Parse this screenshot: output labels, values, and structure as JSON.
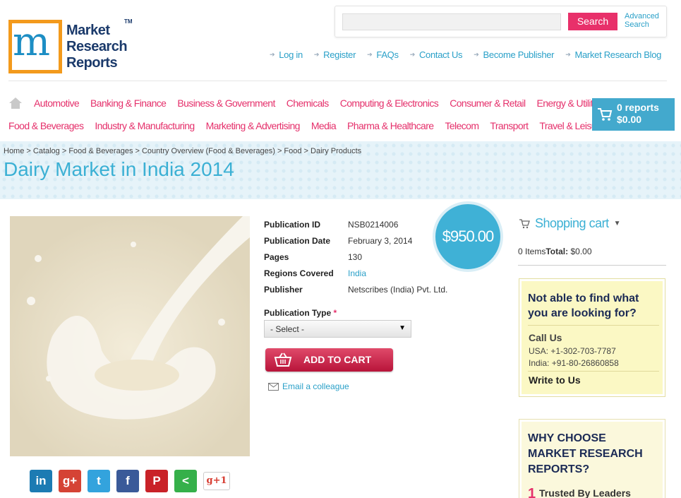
{
  "brand": {
    "logo_line1": "Market",
    "logo_line2": "Research",
    "logo_line3": "Reports",
    "logo_tm": "TM",
    "accent": "#e5306b",
    "link_color": "#2aa0c8"
  },
  "search": {
    "placeholder": "",
    "button_label": "Search",
    "advanced_line1": "Advanced",
    "advanced_line2": "Search"
  },
  "top_links": [
    "Log in",
    "Register",
    "FAQs",
    "Contact Us",
    "Become Publisher",
    "Market Research Blog"
  ],
  "categories_row1": [
    "Automotive",
    "Banking & Finance",
    "Business & Government",
    "Chemicals",
    "Computing & Electronics",
    "Consumer & Retail",
    "Energy & Utilities"
  ],
  "categories_row2": [
    "Food & Beverages",
    "Industry & Manufacturing",
    "Marketing & Advertising",
    "Media",
    "Pharma & Healthcare",
    "Telecom",
    "Transport",
    "Travel & Leisure"
  ],
  "header_cart": {
    "reports": "0 reports",
    "total": "$0.00"
  },
  "breadcrumb": "Home > Catalog > Food & Beverages > Country Overview (Food & Beverages) > Food > Dairy Products",
  "page_title": "Dairy Market in India 2014",
  "product": {
    "publication_id_label": "Publication ID",
    "publication_id": "NSB0214006",
    "publication_date_label": "Publication Date",
    "publication_date": "February 3, 2014",
    "pages_label": "Pages",
    "pages": "130",
    "regions_label": "Regions Covered",
    "regions": "India",
    "publisher_label": "Publisher",
    "publisher": "Netscribes (India) Pvt. Ltd.",
    "price": "$950.00",
    "pub_type_label": "Publication Type",
    "pub_type_required": "*",
    "pub_type_selected": "- Select -",
    "add_to_cart": "ADD TO CART",
    "email_colleague": "Email a colleague"
  },
  "social": {
    "linkedin": "in",
    "googleplus": "g+",
    "twitter": "t",
    "facebook": "f",
    "pinterest": "P",
    "share": "<",
    "gplus_one": "g+1"
  },
  "sidebar": {
    "shopping_cart": "Shopping cart",
    "items_text": "0 Items",
    "total_label": "Total:",
    "total_value": " $0.00",
    "help_question_line1": "Not able to find what",
    "help_question_line2": "you are looking for?",
    "call_us": "Call Us",
    "usa_phone": "USA: +1-302-703-7787",
    "india_phone": "India: +91-80-26860858",
    "write_to_us": "Write to Us",
    "why_line1": "WHY CHOOSE",
    "why_line2": "MARKET RESEARCH",
    "why_line3": "REPORTS?",
    "reason_number": "1",
    "reason_1": "Trusted By Leaders"
  }
}
